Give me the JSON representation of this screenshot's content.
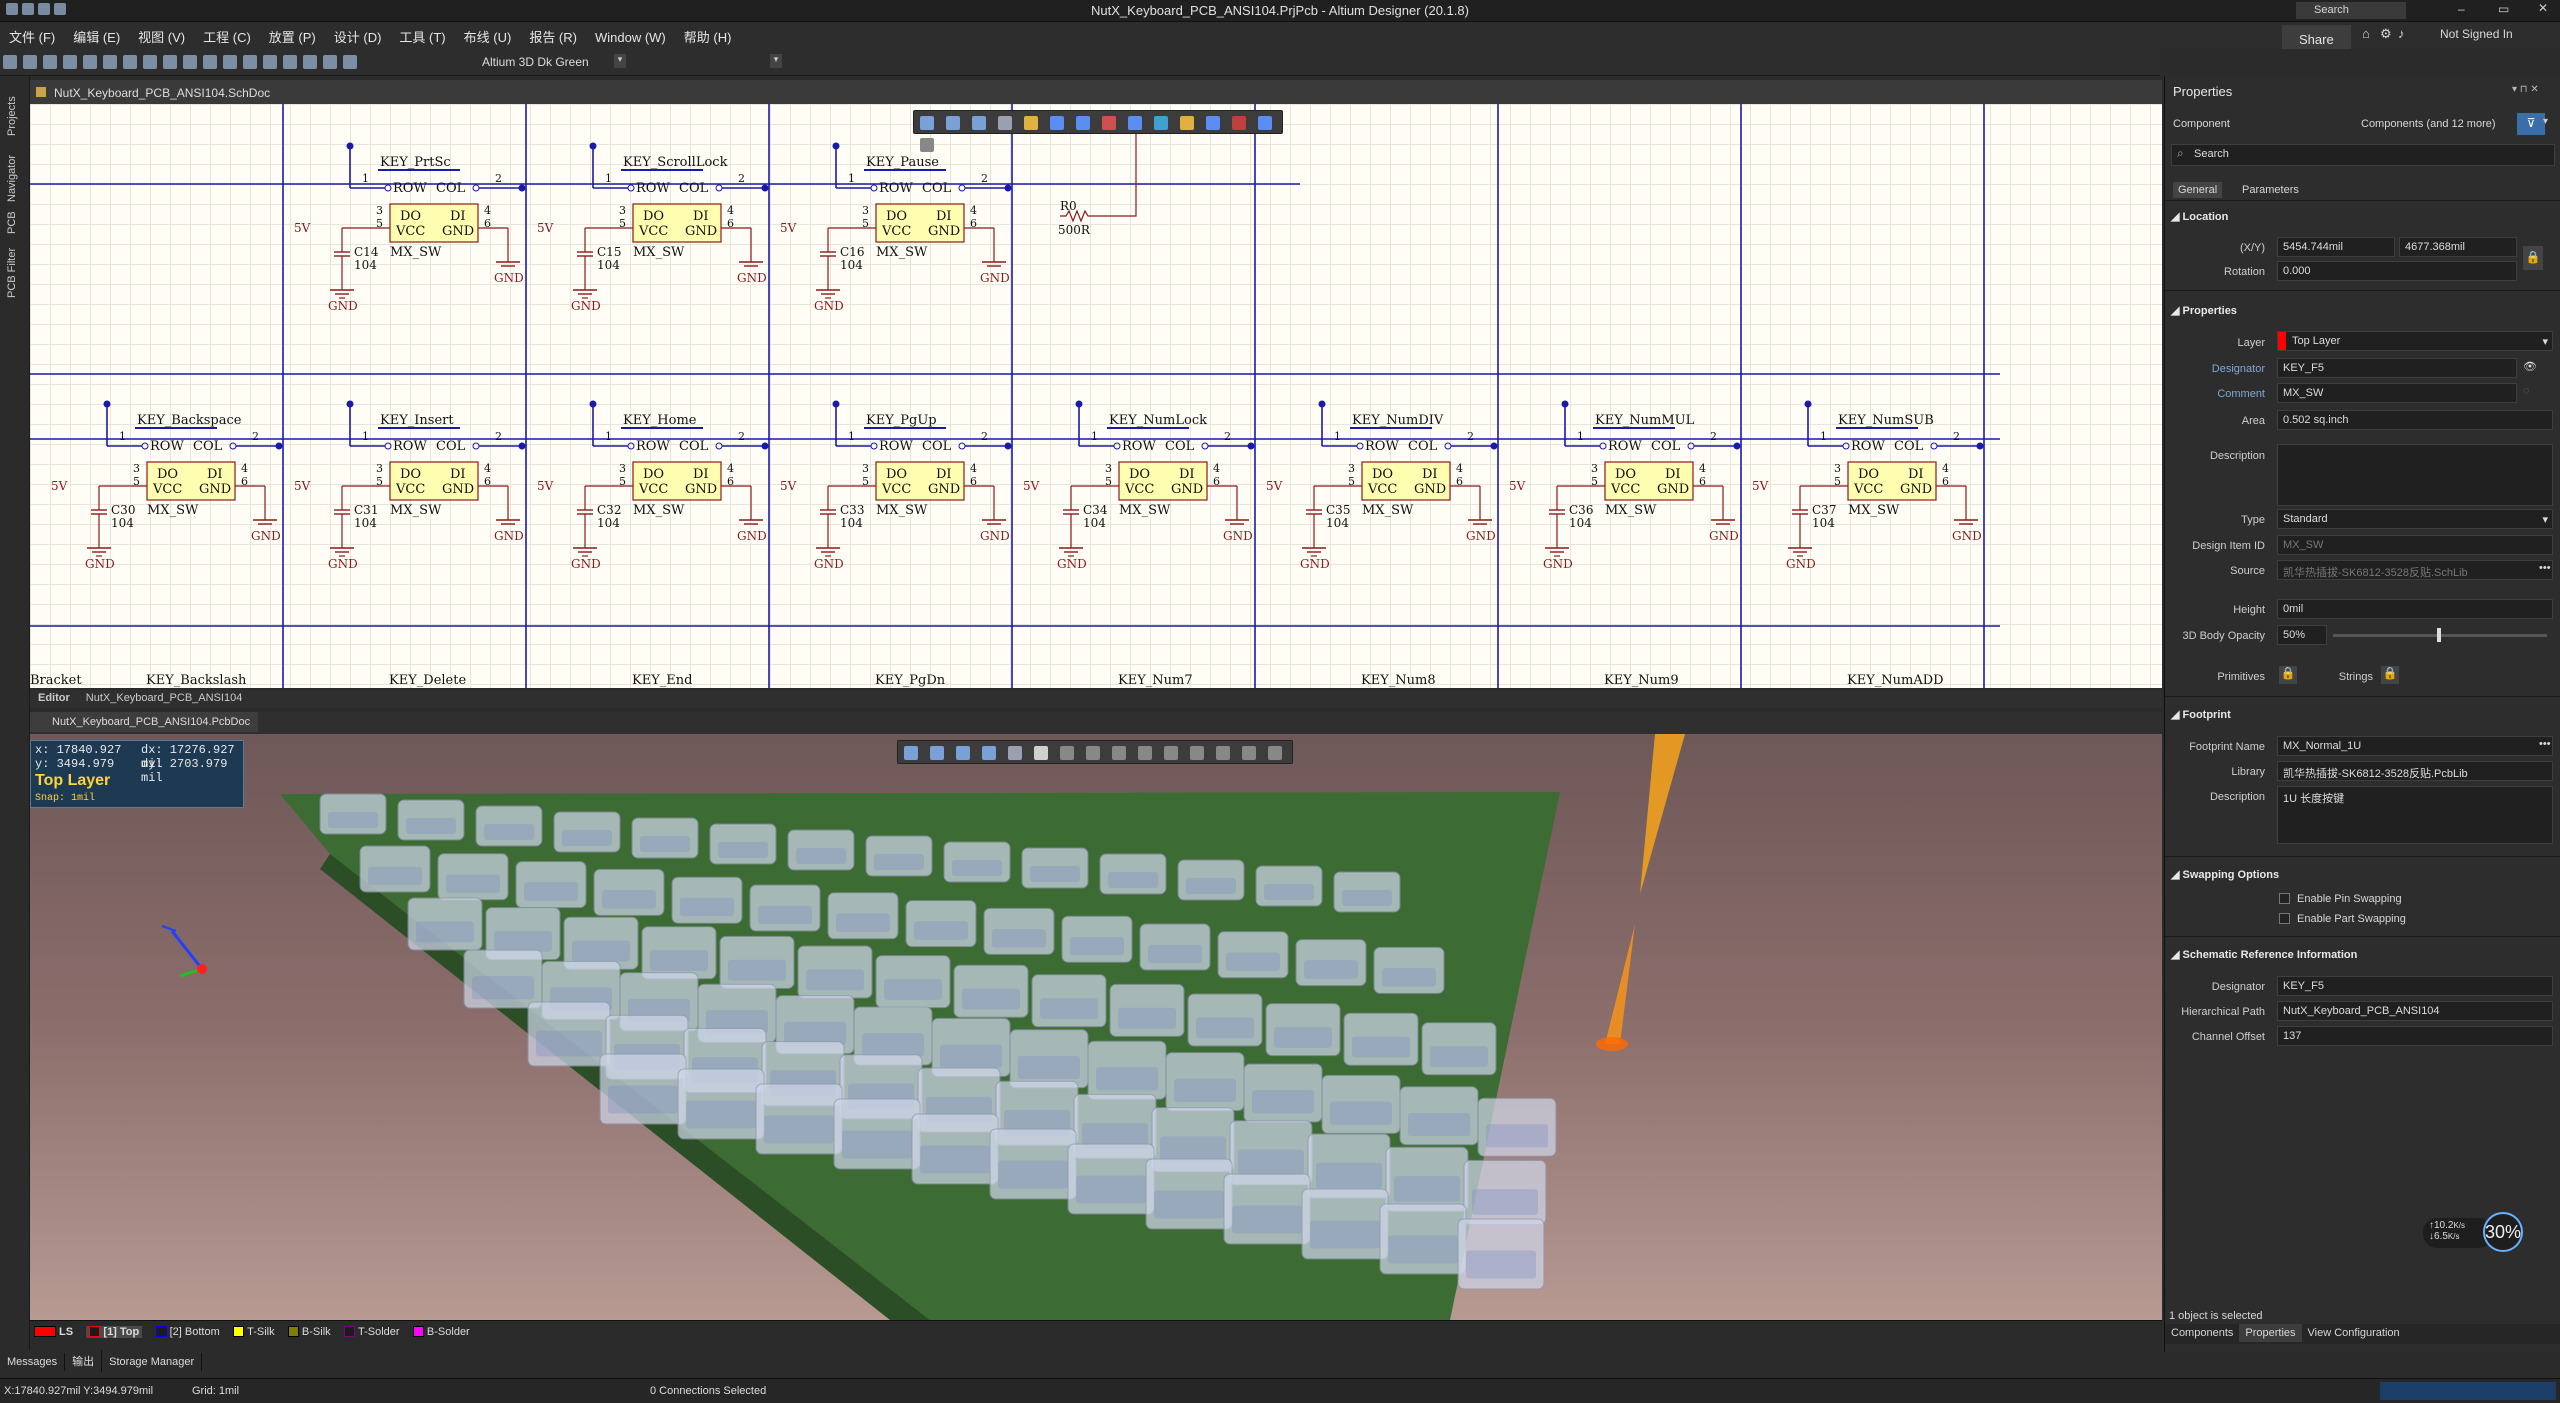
{
  "window": {
    "title": "NutX_Keyboard_PCB_ANSI104.PrjPcb - Altium Designer (20.1.8)",
    "search_placeholder": "Search",
    "share": "Share",
    "user": "Not Signed In"
  },
  "menu": [
    "文件 (F)",
    "编辑 (E)",
    "视图 (V)",
    "工程 (C)",
    "放置 (P)",
    "设计 (D)",
    "工具 (T)",
    "布线 (U)",
    "报告 (R)",
    "Window (W)",
    "帮助 (H)"
  ],
  "toolbar": {
    "theme": "Altium 3D Dk Green"
  },
  "left_panels": [
    "Projects",
    "Navigator",
    "PCB",
    "PCB Filter"
  ],
  "schematic": {
    "tab": "NutX_Keyboard_PCB_ANSI104.SchDoc",
    "resistor": {
      "ref": "R0",
      "value": "500R"
    },
    "row1": [
      {
        "key": "KEY_PrtSc",
        "cap": "C14"
      },
      {
        "key": "KEY_ScrollLock",
        "cap": "C15"
      },
      {
        "key": "KEY_Pause",
        "cap": "C16"
      }
    ],
    "row2": [
      {
        "key": "KEY_Backspace",
        "cap": "C30"
      },
      {
        "key": "KEY_Insert",
        "cap": "C31"
      },
      {
        "key": "KEY_Home",
        "cap": "C32"
      },
      {
        "key": "KEY_PgUp",
        "cap": "C33"
      },
      {
        "key": "KEY_NumLock",
        "cap": "C34"
      },
      {
        "key": "KEY_NumDIV",
        "cap": "C35"
      },
      {
        "key": "KEY_NumMUL",
        "cap": "C36"
      },
      {
        "key": "KEY_NumSUB",
        "cap": "C37"
      }
    ],
    "row3": [
      "Bracket",
      "KEY_Backslash",
      "KEY_Delete",
      "KEY_End",
      "KEY_PgDn",
      "KEY_Num7",
      "KEY_Num8",
      "KEY_Num9",
      "KEY_NumADD"
    ],
    "pin_row": "ROW",
    "pin_col": "COL",
    "pin_do": "DO",
    "pin_di": "DI",
    "pin_vcc": "VCC",
    "pin_gnd": "GND",
    "part": "MX_SW",
    "capval": "104",
    "gnd": "GND",
    "v5": "5V",
    "n1": "1",
    "n2": "2",
    "n3": "3",
    "n4": "4",
    "n5": "5",
    "n6": "6"
  },
  "editor_tabs": [
    "Editor",
    "NutX_Keyboard_PCB_ANSI104"
  ],
  "pcb": {
    "tab": "NutX_Keyboard_PCB_ANSI104.PcbDoc",
    "coords": {
      "x": "x: 17840.927",
      "dx": "dx: 17276.927 mil",
      "y": "y:  3494.979",
      "dy": "dy:  2703.979 mil",
      "layer": "Top Layer",
      "snap": "Snap: 1mil"
    }
  },
  "layers": [
    {
      "name": "LS",
      "color": "#ff0000"
    },
    {
      "name": "[1] Top",
      "color": "#ff0000"
    },
    {
      "name": "[2] Bottom",
      "color": "#0000ff"
    },
    {
      "name": "T-Silk",
      "color": "#ffff00"
    },
    {
      "name": "B-Silk",
      "color": "#808000"
    },
    {
      "name": "T-Solder",
      "color": "#800080"
    },
    {
      "name": "B-Solder",
      "color": "#ff00ff"
    }
  ],
  "bottom_tabs": [
    "Messages",
    "输出",
    "Storage Manager"
  ],
  "status": {
    "coords": "X:17840.927mil Y:3494.979mil",
    "grid": "Grid: 1mil",
    "connections": "0 Connections Selected"
  },
  "properties": {
    "title": "Properties",
    "component": "Component",
    "filter_text": "Components (and 12 more)",
    "search": "Search",
    "tabs": [
      "General",
      "Parameters"
    ],
    "location": {
      "title": "Location",
      "xy_label": "(X/Y)",
      "x": "5454.744mil",
      "y": "4677.368mil",
      "rot_label": "Rotation",
      "rot": "0.000"
    },
    "props": {
      "title": "Properties",
      "layer_label": "Layer",
      "layer": "Top Layer",
      "des_label": "Designator",
      "des": "KEY_F5",
      "com_label": "Comment",
      "com": "MX_SW",
      "area_label": "Area",
      "area": "0.502 sq.inch",
      "desc_label": "Description",
      "type_label": "Type",
      "type": "Standard",
      "dii_label": "Design Item ID",
      "dii": "MX_SW",
      "src_label": "Source",
      "src": "凯华热插拔-SK6812-3528反贴.SchLib",
      "height_label": "Height",
      "height": "0mil",
      "opacity_label": "3D Body Opacity",
      "opacity": "50%",
      "prim_label": "Primitives",
      "strings_label": "Strings"
    },
    "footprint": {
      "title": "Footprint",
      "name_label": "Footprint Name",
      "name": "MX_Normal_1U",
      "lib_label": "Library",
      "lib": "凯华热插拔-SK6812-3528反贴.PcbLib",
      "desc_label": "Description",
      "desc": "1U 长度按键"
    },
    "swap": {
      "title": "Swapping Options",
      "pin": "Enable Pin Swapping",
      "part": "Enable Part Swapping"
    },
    "sri": {
      "title": "Schematic Reference Information",
      "des_label": "Designator",
      "des": "KEY_F5",
      "hp_label": "Hierarchical Path",
      "hp": "NutX_Keyboard_PCB_ANSI104",
      "co_label": "Channel Offset",
      "co": "137"
    },
    "selected": "1 object is selected",
    "footer_tabs": [
      "Components",
      "Properties",
      "View Configuration"
    ]
  },
  "netmeter": {
    "up": "10.2",
    "down": "6.5",
    "unit": "K/s",
    "pct": "30%"
  }
}
